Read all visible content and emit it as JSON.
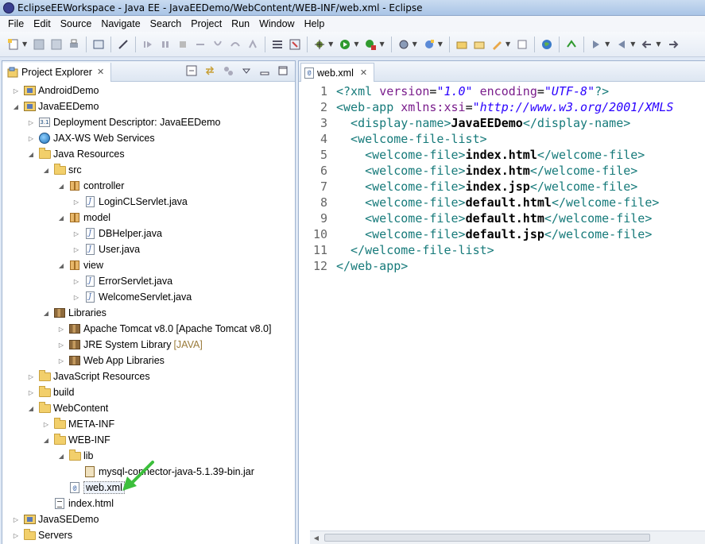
{
  "window": {
    "title": "EclipseEEWorkspace - Java EE - JavaEEDemo/WebContent/WEB-INF/web.xml - Eclipse"
  },
  "menu": [
    "File",
    "Edit",
    "Source",
    "Navigate",
    "Search",
    "Project",
    "Run",
    "Window",
    "Help"
  ],
  "explorer": {
    "tab_label": "Project Explorer",
    "close_glyph": "✕",
    "items": [
      {
        "label": "AndroidDemo",
        "icon": "project-icon",
        "arrow": "▷"
      },
      {
        "label": "JavaEEDemo",
        "icon": "project-icon",
        "arrow": "◢"
      },
      {
        "label": "Deployment Descriptor: JavaEEDemo",
        "icon": "deployment-descriptor-icon",
        "arrow": "▷"
      },
      {
        "label": "JAX-WS Web Services",
        "icon": "globe-icon",
        "arrow": "▷"
      },
      {
        "label": "Java Resources",
        "icon": "folder-icon",
        "arrow": "◢"
      },
      {
        "label": "src",
        "icon": "folder-icon",
        "arrow": "◢"
      },
      {
        "label": "controller",
        "icon": "package-icon",
        "arrow": "◢"
      },
      {
        "label": "LoginCLServlet.java",
        "icon": "java-file-icon",
        "arrow": "▷"
      },
      {
        "label": "model",
        "icon": "package-icon",
        "arrow": "◢"
      },
      {
        "label": "DBHelper.java",
        "icon": "java-file-icon",
        "arrow": "▷"
      },
      {
        "label": "User.java",
        "icon": "java-file-icon",
        "arrow": "▷"
      },
      {
        "label": "view",
        "icon": "package-icon",
        "arrow": "◢"
      },
      {
        "label": "ErrorServlet.java",
        "icon": "java-file-icon",
        "arrow": "▷"
      },
      {
        "label": "WelcomeServlet.java",
        "icon": "java-file-icon",
        "arrow": "▷"
      },
      {
        "label": "Libraries",
        "icon": "library-icon",
        "arrow": "◢"
      },
      {
        "label": "Apache Tomcat v8.0 [Apache Tomcat v8.0]",
        "icon": "library-icon",
        "arrow": "▷"
      },
      {
        "label": "JRE System Library",
        "suffix": "[JAVA]",
        "icon": "library-icon",
        "arrow": "▷"
      },
      {
        "label": "Web App Libraries",
        "icon": "library-icon",
        "arrow": "▷"
      },
      {
        "label": "JavaScript Resources",
        "icon": "folder-icon",
        "arrow": "▷"
      },
      {
        "label": "build",
        "icon": "folder-icon",
        "arrow": "▷"
      },
      {
        "label": "WebContent",
        "icon": "folder-icon",
        "arrow": "◢"
      },
      {
        "label": "META-INF",
        "icon": "folder-icon",
        "arrow": "▷"
      },
      {
        "label": "WEB-INF",
        "icon": "folder-icon",
        "arrow": "◢"
      },
      {
        "label": "lib",
        "icon": "folder-icon",
        "arrow": "◢"
      },
      {
        "label": "mysql-connector-java-5.1.39-bin.jar",
        "icon": "jar-icon",
        "arrow": ""
      },
      {
        "label": "web.xml",
        "icon": "xml-file-icon",
        "arrow": "",
        "selected": true
      },
      {
        "label": "index.html",
        "icon": "html-file-icon",
        "arrow": ""
      },
      {
        "label": "JavaSEDemo",
        "icon": "project-icon",
        "arrow": "▷"
      },
      {
        "label": "Servers",
        "icon": "folder-icon",
        "arrow": "▷"
      }
    ]
  },
  "editor": {
    "tab_label": "web.xml",
    "close_glyph": "✕",
    "lines": [
      "1",
      "2",
      "3",
      "4",
      "5",
      "6",
      "7",
      "8",
      "9",
      "10",
      "11",
      "12"
    ],
    "code": {
      "l1_a": "<?xml ",
      "l1_b": "version",
      "l1_c": "=",
      "l1_d": "\"1.0\"",
      "l1_e": " encoding",
      "l1_f": "=",
      "l1_g": "\"UTF-8\"",
      "l1_h": "?>",
      "l2_a": "<web-app ",
      "l2_b": "xmlns:xsi",
      "l2_c": "=",
      "l2_d": "\"http://www.w3.org/2001/XMLS",
      "l3_a": "  <display-name>",
      "l3_b": "JavaEEDemo",
      "l3_c": "</display-name>",
      "l4_a": "  <welcome-file-list>",
      "l5_a": "    <welcome-file>",
      "l5_b": "index.html",
      "l5_c": "</welcome-file>",
      "l6_a": "    <welcome-file>",
      "l6_b": "index.htm",
      "l6_c": "</welcome-file>",
      "l7_a": "    <welcome-file>",
      "l7_b": "index.jsp",
      "l7_c": "</welcome-file>",
      "l8_a": "    <welcome-file>",
      "l8_b": "default.html",
      "l8_c": "</welcome-file>",
      "l9_a": "    <welcome-file>",
      "l9_b": "default.htm",
      "l9_c": "</welcome-file>",
      "l10_a": "    <welcome-file>",
      "l10_b": "default.jsp",
      "l10_c": "</welcome-file>",
      "l11_a": "  </welcome-file-list>",
      "l12_a": "</web-app>"
    }
  },
  "colors": {
    "tag": "#167a7a",
    "attr": "#7a1d8c",
    "value": "#2a00ff",
    "annotation_arrow": "#3cbf3c"
  }
}
